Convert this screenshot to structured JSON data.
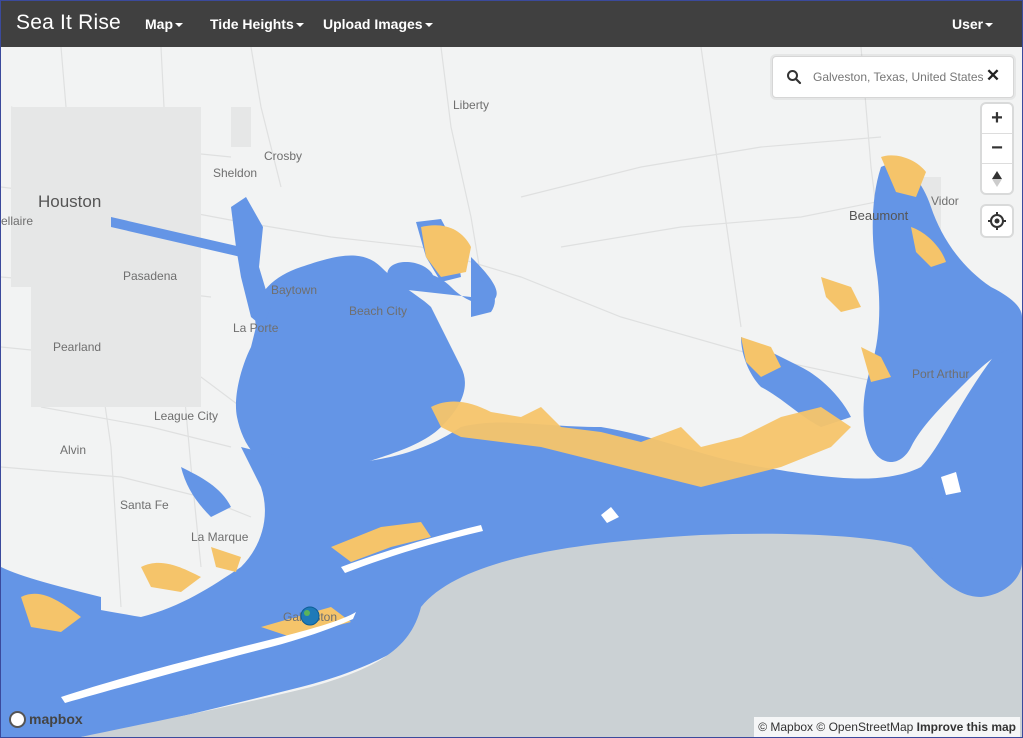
{
  "app": {
    "brand": "Sea It Rise",
    "nav": [
      {
        "label": "Map"
      },
      {
        "label": "Tide Heights"
      },
      {
        "label": "Upload Images"
      }
    ],
    "user_label": "User"
  },
  "search": {
    "value": "Galveston, Texas, United States",
    "icon": "search-icon",
    "clear_icon": "close-icon"
  },
  "map_controls": {
    "zoom_in": "+",
    "zoom_out": "−",
    "compass_icon": "compass-icon",
    "geolocate_icon": "geolocate-icon"
  },
  "places": {
    "houston": "Houston",
    "liberty": "Liberty",
    "sheldon": "Sheldon",
    "crosby": "Crosby",
    "beaumont": "Beaumont",
    "vidor": "Vidor",
    "baytown": "Baytown",
    "pasadena": "Pasadena",
    "beach_city": "Beach City",
    "la_porte": "La Porte",
    "pearland": "Pearland",
    "port_arthur": "Port Arthur",
    "league_city": "League City",
    "alvin": "Alvin",
    "santa_fe": "Santa Fe",
    "la_marque": "La Marque",
    "galveston": "Galveston",
    "bellaire": "ellaire"
  },
  "colors": {
    "navbar": "#404040",
    "land": "#f2f3f3",
    "water_flood": "#6495e6",
    "gulf": "#cbd1d4",
    "flood_risk": "#f5c46a"
  },
  "footer": {
    "logo_text": "mapbox",
    "attribution_mapbox": "© Mapbox",
    "attribution_osm": "© OpenStreetMap",
    "improve": "Improve this map"
  }
}
